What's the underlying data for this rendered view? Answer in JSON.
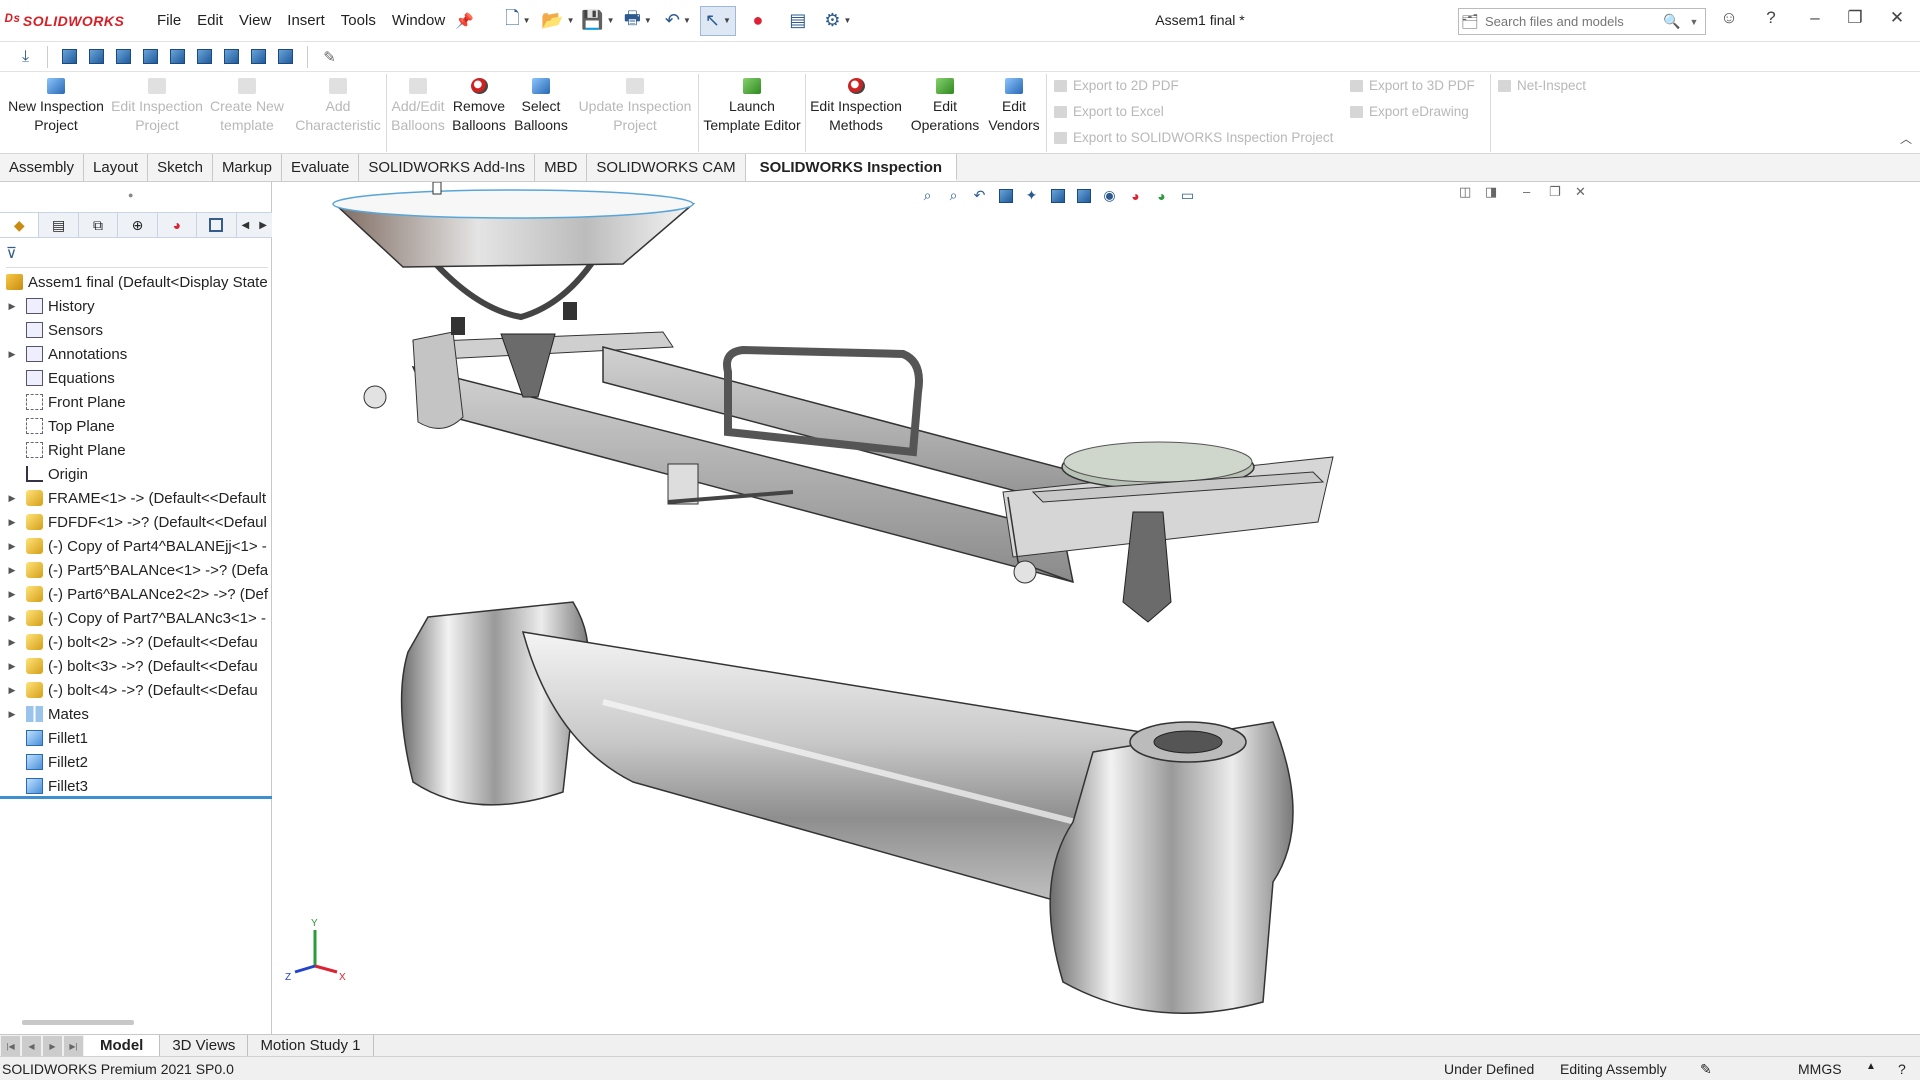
{
  "app": {
    "brand": "SOLIDWORKS",
    "document_title": "Assem1 final *"
  },
  "menu": [
    "File",
    "Edit",
    "View",
    "Insert",
    "Tools",
    "Window"
  ],
  "search": {
    "placeholder": "Search files and models"
  },
  "ribbon": {
    "buttons": [
      {
        "label1": "New Inspection",
        "label2": "Project",
        "enabled": true
      },
      {
        "label1": "Edit Inspection",
        "label2": "Project",
        "enabled": false
      },
      {
        "label1": "Create New",
        "label2": "template",
        "enabled": false
      },
      {
        "label1": "Add",
        "label2": "Characteristic",
        "enabled": false
      },
      {
        "label1": "Add/Edit",
        "label2": "Balloons",
        "enabled": false
      },
      {
        "label1": "Remove",
        "label2": "Balloons",
        "enabled": true
      },
      {
        "label1": "Select",
        "label2": "Balloons",
        "enabled": true
      },
      {
        "label1": "Update Inspection",
        "label2": "Project",
        "enabled": false
      },
      {
        "label1": "Launch",
        "label2": "Template Editor",
        "enabled": true
      },
      {
        "label1": "Edit Inspection",
        "label2": "Methods",
        "enabled": true
      },
      {
        "label1": "Edit",
        "label2": "Operations",
        "enabled": true
      },
      {
        "label1": "Edit",
        "label2": "Vendors",
        "enabled": true
      }
    ],
    "exports": [
      "Export to 2D PDF",
      "Export to Excel",
      "Export to SOLIDWORKS Inspection Project",
      "Export to 3D PDF",
      "Export eDrawing",
      "Net-Inspect"
    ]
  },
  "tabs": [
    "Assembly",
    "Layout",
    "Sketch",
    "Markup",
    "Evaluate",
    "SOLIDWORKS Add-Ins",
    "MBD",
    "SOLIDWORKS CAM",
    "SOLIDWORKS Inspection"
  ],
  "active_tab": "SOLIDWORKS Inspection",
  "tree": {
    "root": "Assem1 final  (Default<Display State",
    "items": [
      {
        "label": "History",
        "icon": "folder-icon",
        "expandable": true
      },
      {
        "label": "Sensors",
        "icon": "sensor-icon",
        "expandable": false
      },
      {
        "label": "Annotations",
        "icon": "annotation-icon",
        "expandable": true
      },
      {
        "label": "Equations",
        "icon": "equation-icon",
        "expandable": false
      },
      {
        "label": "Front Plane",
        "icon": "plane-icon",
        "expandable": false
      },
      {
        "label": "Top Plane",
        "icon": "plane-icon",
        "expandable": false
      },
      {
        "label": "Right Plane",
        "icon": "plane-icon",
        "expandable": false
      },
      {
        "label": "Origin",
        "icon": "origin-icon",
        "expandable": false
      },
      {
        "label": "FRAME<1> -> (Default<<Default",
        "icon": "part-icon",
        "expandable": true
      },
      {
        "label": "FDFDF<1> ->? (Default<<Defaul",
        "icon": "part-icon",
        "expandable": true
      },
      {
        "label": "(-) Copy of Part4^BALANEjj<1> -",
        "icon": "part-icon",
        "expandable": true
      },
      {
        "label": "(-) Part5^BALANce<1> ->? (Defa",
        "icon": "part-icon",
        "expandable": true
      },
      {
        "label": "(-) Part6^BALANce2<2> ->? (Def",
        "icon": "part-icon",
        "expandable": true
      },
      {
        "label": "(-) Copy of Part7^BALANc3<1> -",
        "icon": "part-icon",
        "expandable": true
      },
      {
        "label": "(-) bolt<2> ->? (Default<<Defau",
        "icon": "part-icon",
        "expandable": true
      },
      {
        "label": "(-) bolt<3> ->? (Default<<Defau",
        "icon": "part-icon",
        "expandable": true
      },
      {
        "label": "(-) bolt<4> ->? (Default<<Defau",
        "icon": "part-icon",
        "expandable": true
      },
      {
        "label": "Mates",
        "icon": "mates-icon",
        "expandable": true
      },
      {
        "label": "Fillet1",
        "icon": "fillet-icon",
        "expandable": false
      },
      {
        "label": "Fillet2",
        "icon": "fillet-icon",
        "expandable": false
      },
      {
        "label": "Fillet3",
        "icon": "fillet-icon",
        "expandable": false
      }
    ]
  },
  "bottom_tabs": [
    "Model",
    "3D Views",
    "Motion Study 1"
  ],
  "active_bottom_tab": "Model",
  "status": {
    "left": "SOLIDWORKS Premium 2021 SP0.0",
    "state": "Under Defined",
    "mode": "Editing Assembly",
    "units": "MMGS"
  },
  "triad": {
    "x": "X",
    "y": "Y",
    "z": "Z"
  },
  "colors": {
    "brand_red": "#d71f26",
    "accent_blue": "#3d8fd0",
    "icon_blue": "#2c5a8f"
  }
}
